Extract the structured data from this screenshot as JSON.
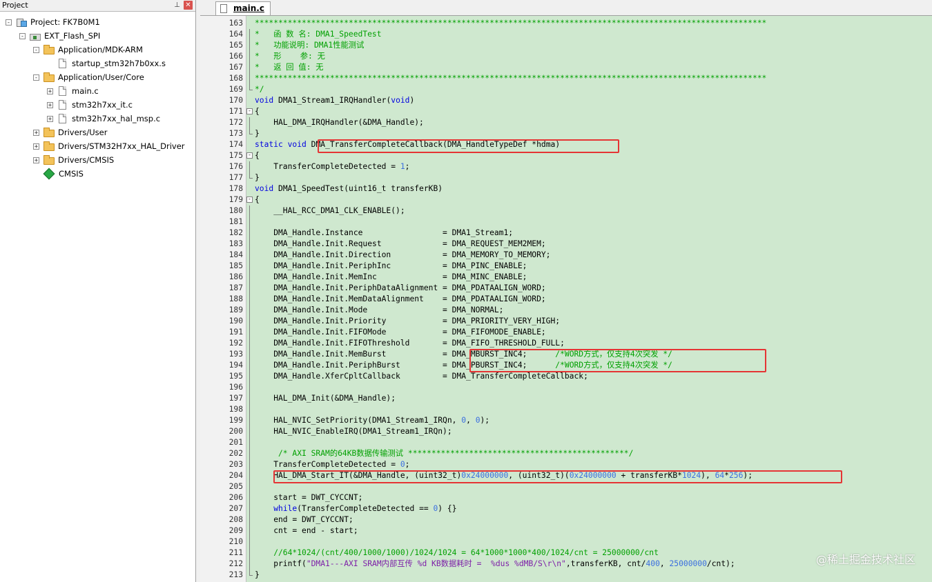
{
  "project_panel": {
    "title": "Project",
    "pin_glyph": "⊥",
    "close_glyph": "✕",
    "tree": [
      {
        "label": "Project: FK7B0M1",
        "icon": "project-icon",
        "expander": "-"
      },
      {
        "label": "EXT_Flash_SPI",
        "icon": "target-icon",
        "expander": "-"
      },
      {
        "label": "Application/MDK-ARM",
        "icon": "folder-open-icon",
        "expander": "-"
      },
      {
        "label": "startup_stm32h7b0xx.s",
        "icon": "file-icon",
        "expander": ""
      },
      {
        "label": "Application/User/Core",
        "icon": "folder-open-icon",
        "expander": "-"
      },
      {
        "label": "main.c",
        "icon": "file-icon",
        "expander": "+"
      },
      {
        "label": "stm32h7xx_it.c",
        "icon": "file-icon",
        "expander": "+"
      },
      {
        "label": "stm32h7xx_hal_msp.c",
        "icon": "file-icon",
        "expander": "+"
      },
      {
        "label": "Drivers/User",
        "icon": "folder-icon",
        "expander": "+"
      },
      {
        "label": "Drivers/STM32H7xx_HAL_Driver",
        "icon": "folder-icon",
        "expander": "+"
      },
      {
        "label": "Drivers/CMSIS",
        "icon": "folder-icon",
        "expander": "+"
      },
      {
        "label": "CMSIS",
        "icon": "cmsis-diamond-icon",
        "expander": ""
      }
    ]
  },
  "editor": {
    "tab_label": "main.c",
    "tab_icon": "c-file-icon",
    "background_color": "#cfe8cf",
    "highlight_color": "#e53434",
    "lines": [
      {
        "no": "163",
        "fold": "",
        "segs": [
          {
            "t": "*************************************************************************************************************",
            "c": "cm"
          }
        ]
      },
      {
        "no": "164",
        "fold": "mid",
        "segs": [
          {
            "t": "*   函 数 名: DMA1_SpeedTest",
            "c": "cm"
          }
        ]
      },
      {
        "no": "165",
        "fold": "mid",
        "segs": [
          {
            "t": "*   功能说明: DMA1性能测试",
            "c": "cm"
          }
        ]
      },
      {
        "no": "166",
        "fold": "mid",
        "segs": [
          {
            "t": "*   形    参: 无",
            "c": "cm"
          }
        ]
      },
      {
        "no": "167",
        "fold": "mid",
        "segs": [
          {
            "t": "*   返 回 值: 无",
            "c": "cm"
          }
        ]
      },
      {
        "no": "168",
        "fold": "mid",
        "segs": [
          {
            "t": "*************************************************************************************************************",
            "c": "cm"
          }
        ]
      },
      {
        "no": "169",
        "fold": "end",
        "segs": [
          {
            "t": "*/",
            "c": "cm"
          }
        ]
      },
      {
        "no": "170",
        "fold": "",
        "segs": [
          {
            "t": "void",
            "c": "kw"
          },
          {
            "t": " DMA1_Stream1_IRQHandler(",
            "c": ""
          },
          {
            "t": "void",
            "c": "kw"
          },
          {
            "t": ")",
            "c": ""
          }
        ]
      },
      {
        "no": "171",
        "fold": "open",
        "segs": [
          {
            "t": "{",
            "c": ""
          }
        ]
      },
      {
        "no": "172",
        "fold": "mid",
        "segs": [
          {
            "t": "    HAL_DMA_IRQHandler(&DMA_Handle);",
            "c": ""
          }
        ]
      },
      {
        "no": "173",
        "fold": "end",
        "segs": [
          {
            "t": "}",
            "c": ""
          }
        ]
      },
      {
        "no": "174",
        "fold": "",
        "segs": [
          {
            "t": "static",
            "c": "kw"
          },
          {
            "t": " ",
            "c": ""
          },
          {
            "t": "void",
            "c": "kw"
          },
          {
            "t": " DMA_TransferCompleteCallback(DMA_HandleTypeDef *hdma)",
            "c": ""
          }
        ]
      },
      {
        "no": "175",
        "fold": "open",
        "segs": [
          {
            "t": "{",
            "c": ""
          }
        ]
      },
      {
        "no": "176",
        "fold": "mid",
        "segs": [
          {
            "t": "    TransferCompleteDetected = ",
            "c": ""
          },
          {
            "t": "1",
            "c": "num"
          },
          {
            "t": ";",
            "c": ""
          }
        ]
      },
      {
        "no": "177",
        "fold": "end",
        "segs": [
          {
            "t": "}",
            "c": ""
          }
        ]
      },
      {
        "no": "178",
        "fold": "",
        "segs": [
          {
            "t": "void",
            "c": "kw"
          },
          {
            "t": " DMA1_SpeedTest(uint16_t transferKB)",
            "c": ""
          }
        ]
      },
      {
        "no": "179",
        "fold": "open",
        "segs": [
          {
            "t": "{",
            "c": ""
          }
        ]
      },
      {
        "no": "180",
        "fold": "mid",
        "segs": [
          {
            "t": "    __HAL_RCC_DMA1_CLK_ENABLE();",
            "c": ""
          }
        ]
      },
      {
        "no": "181",
        "fold": "mid",
        "segs": []
      },
      {
        "no": "182",
        "fold": "mid",
        "segs": [
          {
            "t": "    DMA_Handle.Instance                 = DMA1_Stream1;",
            "c": ""
          }
        ]
      },
      {
        "no": "183",
        "fold": "mid",
        "segs": [
          {
            "t": "    DMA_Handle.Init.Request             = DMA_REQUEST_MEM2MEM;",
            "c": ""
          }
        ]
      },
      {
        "no": "184",
        "fold": "mid",
        "segs": [
          {
            "t": "    DMA_Handle.Init.Direction           = DMA_MEMORY_TO_MEMORY;",
            "c": ""
          }
        ]
      },
      {
        "no": "185",
        "fold": "mid",
        "segs": [
          {
            "t": "    DMA_Handle.Init.PeriphInc           = DMA_PINC_ENABLE;",
            "c": ""
          }
        ]
      },
      {
        "no": "186",
        "fold": "mid",
        "segs": [
          {
            "t": "    DMA_Handle.Init.MemInc              = DMA_MINC_ENABLE;",
            "c": ""
          }
        ]
      },
      {
        "no": "187",
        "fold": "mid",
        "segs": [
          {
            "t": "    DMA_Handle.Init.PeriphDataAlignment = DMA_PDATAALIGN_WORD;",
            "c": ""
          }
        ]
      },
      {
        "no": "188",
        "fold": "mid",
        "segs": [
          {
            "t": "    DMA_Handle.Init.MemDataAlignment    = DMA_PDATAALIGN_WORD;",
            "c": ""
          }
        ]
      },
      {
        "no": "189",
        "fold": "mid",
        "segs": [
          {
            "t": "    DMA_Handle.Init.Mode                = DMA_NORMAL;",
            "c": ""
          }
        ]
      },
      {
        "no": "190",
        "fold": "mid",
        "segs": [
          {
            "t": "    DMA_Handle.Init.Priority            = DMA_PRIORITY_VERY_HIGH;",
            "c": ""
          }
        ]
      },
      {
        "no": "191",
        "fold": "mid",
        "segs": [
          {
            "t": "    DMA_Handle.Init.FIFOMode            = DMA_FIFOMODE_ENABLE;",
            "c": ""
          }
        ]
      },
      {
        "no": "192",
        "fold": "mid",
        "segs": [
          {
            "t": "    DMA_Handle.Init.FIFOThreshold       = DMA_FIFO_THRESHOLD_FULL;",
            "c": ""
          }
        ]
      },
      {
        "no": "193",
        "fold": "mid",
        "segs": [
          {
            "t": "    DMA_Handle.Init.MemBurst            = DMA_MBURST_INC4;      ",
            "c": ""
          },
          {
            "t": "/*WORD方式，仅支持4次突发 */",
            "c": "cm"
          }
        ]
      },
      {
        "no": "194",
        "fold": "mid",
        "segs": [
          {
            "t": "    DMA_Handle.Init.PeriphBurst         = DMA_PBURST_INC4;      ",
            "c": ""
          },
          {
            "t": "/*WORD方式，仅支持4次突发 */",
            "c": "cm"
          }
        ]
      },
      {
        "no": "195",
        "fold": "mid",
        "segs": [
          {
            "t": "    DMA_Handle.XferCpltCallback         = DMA_TransferCompleteCallback;",
            "c": ""
          }
        ]
      },
      {
        "no": "196",
        "fold": "mid",
        "segs": []
      },
      {
        "no": "197",
        "fold": "mid",
        "segs": [
          {
            "t": "    HAL_DMA_Init(&DMA_Handle);",
            "c": ""
          }
        ]
      },
      {
        "no": "198",
        "fold": "mid",
        "segs": []
      },
      {
        "no": "199",
        "fold": "mid",
        "segs": [
          {
            "t": "    HAL_NVIC_SetPriority(DMA1_Stream1_IRQn, ",
            "c": ""
          },
          {
            "t": "0",
            "c": "num"
          },
          {
            "t": ", ",
            "c": ""
          },
          {
            "t": "0",
            "c": "num"
          },
          {
            "t": ");",
            "c": ""
          }
        ]
      },
      {
        "no": "200",
        "fold": "mid",
        "segs": [
          {
            "t": "    HAL_NVIC_EnableIRQ(DMA1_Stream1_IRQn);",
            "c": ""
          }
        ]
      },
      {
        "no": "201",
        "fold": "mid",
        "segs": []
      },
      {
        "no": "202",
        "fold": "mid",
        "segs": [
          {
            "t": "     /* AXI SRAM的64KB数据传输测试 ***********************************************/",
            "c": "cm"
          }
        ]
      },
      {
        "no": "203",
        "fold": "mid",
        "segs": [
          {
            "t": "    TransferCompleteDetected = ",
            "c": ""
          },
          {
            "t": "0",
            "c": "num"
          },
          {
            "t": ";",
            "c": ""
          }
        ]
      },
      {
        "no": "204",
        "fold": "mid",
        "segs": [
          {
            "t": "    HAL_DMA_Start_IT(&DMA_Handle, (uint32_t)",
            "c": ""
          },
          {
            "t": "0x24000000",
            "c": "num"
          },
          {
            "t": ", (uint32_t)(",
            "c": ""
          },
          {
            "t": "0x24000000",
            "c": "num"
          },
          {
            "t": " + transferKB*",
            "c": ""
          },
          {
            "t": "1024",
            "c": "num"
          },
          {
            "t": "), ",
            "c": ""
          },
          {
            "t": "64",
            "c": "num"
          },
          {
            "t": "*",
            "c": ""
          },
          {
            "t": "256",
            "c": "num"
          },
          {
            "t": ");",
            "c": ""
          }
        ]
      },
      {
        "no": "205",
        "fold": "mid",
        "segs": []
      },
      {
        "no": "206",
        "fold": "mid",
        "segs": [
          {
            "t": "    start = DWT_CYCCNT;",
            "c": ""
          }
        ]
      },
      {
        "no": "207",
        "fold": "mid",
        "segs": [
          {
            "t": "    ",
            "c": ""
          },
          {
            "t": "while",
            "c": "kw"
          },
          {
            "t": "(TransferCompleteDetected == ",
            "c": ""
          },
          {
            "t": "0",
            "c": "num"
          },
          {
            "t": ") {}",
            "c": ""
          }
        ]
      },
      {
        "no": "208",
        "fold": "mid",
        "segs": [
          {
            "t": "    end = DWT_CYCCNT;",
            "c": ""
          }
        ]
      },
      {
        "no": "209",
        "fold": "mid",
        "segs": [
          {
            "t": "    cnt = end - start;",
            "c": ""
          }
        ]
      },
      {
        "no": "210",
        "fold": "mid",
        "segs": []
      },
      {
        "no": "211",
        "fold": "mid",
        "segs": [
          {
            "t": "    //64*1024/(cnt/400/1000/1000)/1024/1024 = 64*1000*1000*400/1024/cnt = 25000000/cnt",
            "c": "cm"
          }
        ]
      },
      {
        "no": "212",
        "fold": "mid",
        "segs": [
          {
            "t": "    printf(",
            "c": ""
          },
          {
            "t": "\"DMA1---AXI SRAM内部互传 %d KB数据耗时 =  %dus %dMB/S\\r\\n\"",
            "c": "str"
          },
          {
            "t": ",transferKB, cnt/",
            "c": ""
          },
          {
            "t": "400",
            "c": "num"
          },
          {
            "t": ", ",
            "c": ""
          },
          {
            "t": "25000000",
            "c": "num"
          },
          {
            "t": "/cnt);",
            "c": ""
          }
        ]
      },
      {
        "no": "213",
        "fold": "end",
        "segs": [
          {
            "t": "}",
            "c": ""
          }
        ]
      }
    ]
  },
  "watermark": "@稀土掘金技术社区"
}
